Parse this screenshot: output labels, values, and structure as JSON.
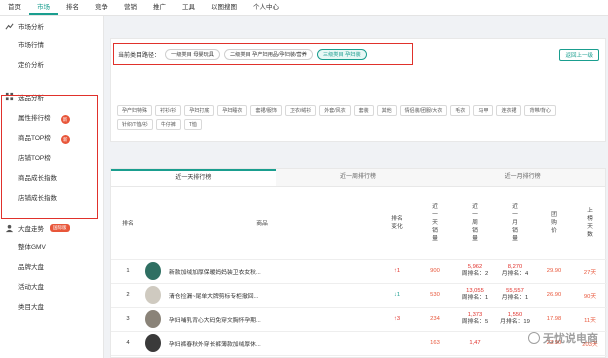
{
  "topnav": {
    "items": [
      "首页",
      "市场",
      "排名",
      "竞争",
      "营销",
      "推广",
      "工具",
      "以图搜图",
      "个人中心"
    ],
    "active_index": 1
  },
  "sidebar": {
    "market_section": "市场分析",
    "market_items": [
      "市场行情",
      "定价分析"
    ],
    "select_section": "选品分析",
    "select_items": [
      {
        "label": "属性排行榜",
        "badge": "新"
      },
      {
        "label": "商品TOP榜",
        "badge": "新"
      },
      {
        "label": "店铺TOP榜",
        "badge": ""
      },
      {
        "label": "商品成长指数",
        "badge": ""
      },
      {
        "label": "店铺成长指数",
        "badge": ""
      }
    ],
    "big_section": "大盘走势",
    "big_badge": "国际版",
    "big_items": [
      "整体GMV",
      "品牌大盘",
      "活动大盘",
      "类目大盘"
    ]
  },
  "category": {
    "path_label": "当前类目路径：",
    "path": [
      "一级类目 母婴玩具",
      "二级类目 孕产妇用品/孕妇装/营养",
      "三级类目 孕妇装"
    ],
    "back_label": "返回上一级",
    "sub_tags": [
      "孕产妇特殊",
      "衬衫/衫",
      "孕妇打底",
      "孕妇睡衣",
      "套裙/服饰",
      "卫衣/绒衫",
      "外套/风衣",
      "套装",
      "其他",
      "情侣装/团服/大衣",
      "毛衣",
      "马甲",
      "连衣裙",
      "背带/背心",
      "针织/T恤/衫",
      "牛仔裤",
      "T恤"
    ]
  },
  "table": {
    "tabs": [
      "近一天排行榜",
      "近一周排行榜",
      "近一月排行榜"
    ],
    "active_tab": 0,
    "headers": {
      "rank": "排名",
      "product": "商品",
      "change": "排名变化",
      "day_sales": "近一天销量",
      "week_sales": "近一周销量",
      "month_sales": "近一月销量",
      "price": "团购价",
      "days": "上榜天数"
    },
    "rows": [
      {
        "rank": "1",
        "name": "新款加绒加厚保暖妈妈装卫衣女秋...",
        "change": "↑1",
        "change_dir": "up",
        "day": "900",
        "week": "5,962",
        "week_sub": "周排名：2",
        "month": "8,270",
        "month_sub": "月排名：4",
        "price": "29.90",
        "days": "27天",
        "thumb": "#2f6f62"
      },
      {
        "rank": "2",
        "name": "清仓捡漏~尾单大牌剪标专柜撤回...",
        "change": "↓1",
        "change_dir": "down",
        "day": "530",
        "week": "13,055",
        "week_sub": "周排名：1",
        "month": "55,557",
        "month_sub": "月排名：1",
        "price": "26.90",
        "days": "90天",
        "thumb": "#cfcac0"
      },
      {
        "rank": "3",
        "name": "孕妇哺乳背心大码免穿文胸怀孕期...",
        "change": "↑3",
        "change_dir": "up",
        "day": "234",
        "week": "1,373",
        "week_sub": "周排名：5",
        "month": "1,550",
        "month_sub": "月排名：19",
        "price": "17.98",
        "days": "11天",
        "thumb": "#8a8378"
      },
      {
        "rank": "4",
        "name": "孕妇裤春秋外穿长裤薄款加绒厚休...",
        "change": "",
        "change_dir": "",
        "day": "163",
        "week": "1,47",
        "week_sub": "",
        "month": "",
        "month_sub": "",
        "price": "23.90",
        "days": "203天",
        "thumb": "#3a3a3a"
      }
    ]
  },
  "watermark": "无忧说电商"
}
